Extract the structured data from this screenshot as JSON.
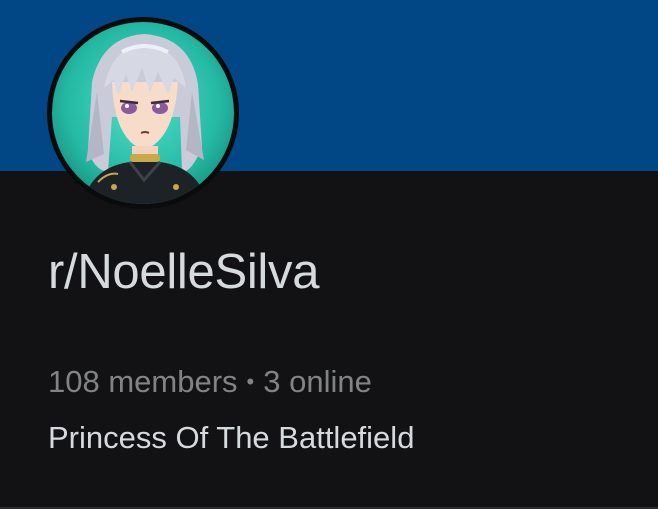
{
  "banner": {
    "color": "#014685"
  },
  "community": {
    "name": "r/NoelleSilva",
    "members": "108 members",
    "separator": "•",
    "online": "3 online",
    "description": "Princess Of The Battlefield",
    "avatar_icon": "community-avatar-image"
  },
  "colors": {
    "background": "#121214",
    "primary_text": "#d7dadc",
    "secondary_text": "#818384",
    "avatar_bg": "#2ec7b2"
  }
}
